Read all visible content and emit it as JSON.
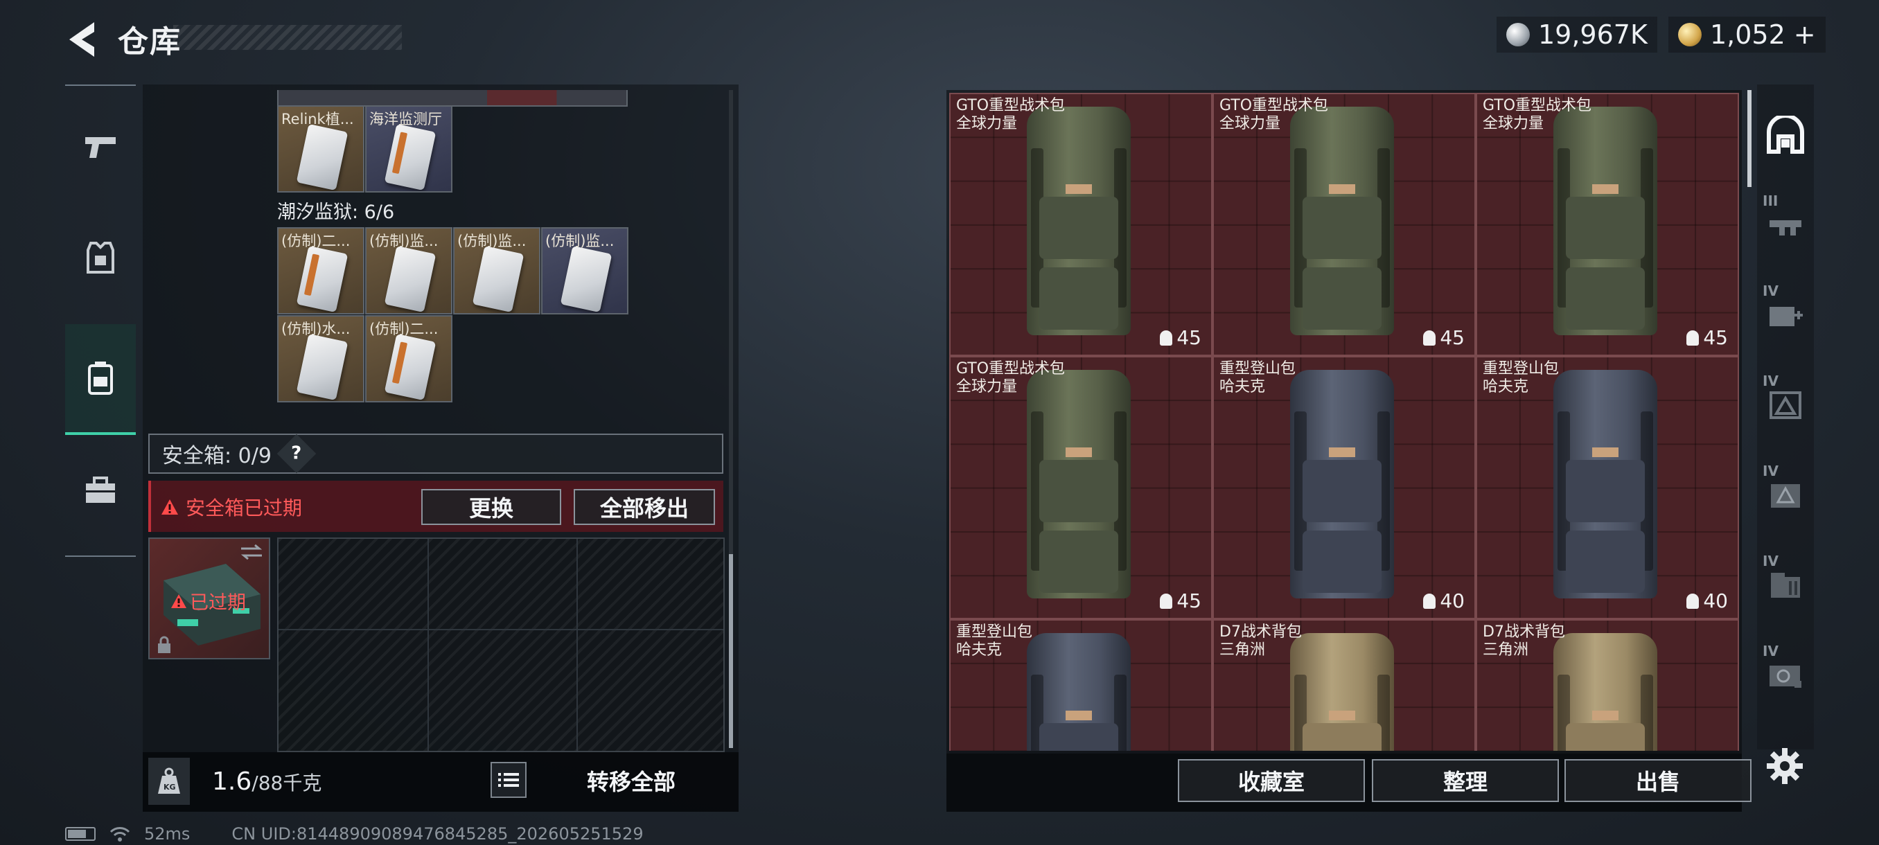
{
  "header": {
    "title": "仓库",
    "currency_silver": "19,967K",
    "currency_gold": "1,052",
    "currency_gold_plus": "+"
  },
  "left_nav": [
    "weapon-tab",
    "equipment-tab",
    "backpack-tab",
    "toolbox-tab"
  ],
  "left_panel": {
    "top_items": [
      {
        "label": "Relink植..."
      },
      {
        "label": "海洋监测厅"
      }
    ],
    "section_label": "潮汐监狱: 6/6",
    "section_items": [
      {
        "label": "(仿制)二..."
      },
      {
        "label": "(仿制)监..."
      },
      {
        "label": "(仿制)监..."
      },
      {
        "label": "(仿制)监..."
      },
      {
        "label": "(仿制)水..."
      },
      {
        "label": "(仿制)二..."
      }
    ],
    "safebox": {
      "label": "安全箱: 0/9",
      "help": "?",
      "expired_warning": "安全箱已过期",
      "replace_button": "更换",
      "move_all_out_button": "全部移出",
      "case_status": "已过期"
    },
    "footer": {
      "weight_current": "1.6",
      "weight_max": "/88千克",
      "transfer_all_button": "转移全部"
    }
  },
  "stash": {
    "items": [
      {
        "name": "GTO重型战术包",
        "brand": "全球力量",
        "qty": "45",
        "style": "green"
      },
      {
        "name": "GTO重型战术包",
        "brand": "全球力量",
        "qty": "45",
        "style": "green"
      },
      {
        "name": "GTO重型战术包",
        "brand": "全球力量",
        "qty": "45",
        "style": "green"
      },
      {
        "name": "GTO重型战术包",
        "brand": "全球力量",
        "qty": "45",
        "style": "green"
      },
      {
        "name": "重型登山包",
        "brand": "哈夫克",
        "qty": "40",
        "style": "grey"
      },
      {
        "name": "重型登山包",
        "brand": "哈夫克",
        "qty": "40",
        "style": "grey"
      },
      {
        "name": "重型登山包",
        "brand": "哈夫克",
        "qty": "",
        "style": "grey"
      },
      {
        "name": "D7战术背包",
        "brand": "三角洲",
        "qty": "",
        "style": "tan"
      },
      {
        "name": "D7战术背包",
        "brand": "三角洲",
        "qty": "",
        "style": "tan"
      }
    ],
    "footer": {
      "collection_button": "收藏室",
      "sort_button": "整理",
      "sell_button": "出售"
    }
  },
  "right_nav": {
    "levels": [
      "III",
      "IV",
      "IV",
      "IV",
      "IV",
      "IV"
    ]
  },
  "status_bar": {
    "ping": "52ms",
    "uid": "CN UID:8144890908947684528​5_202605251529"
  },
  "colors": {
    "accent": "#3fd0a8",
    "warning": "#ff5a5a",
    "stash_bg": "#4a2226"
  }
}
